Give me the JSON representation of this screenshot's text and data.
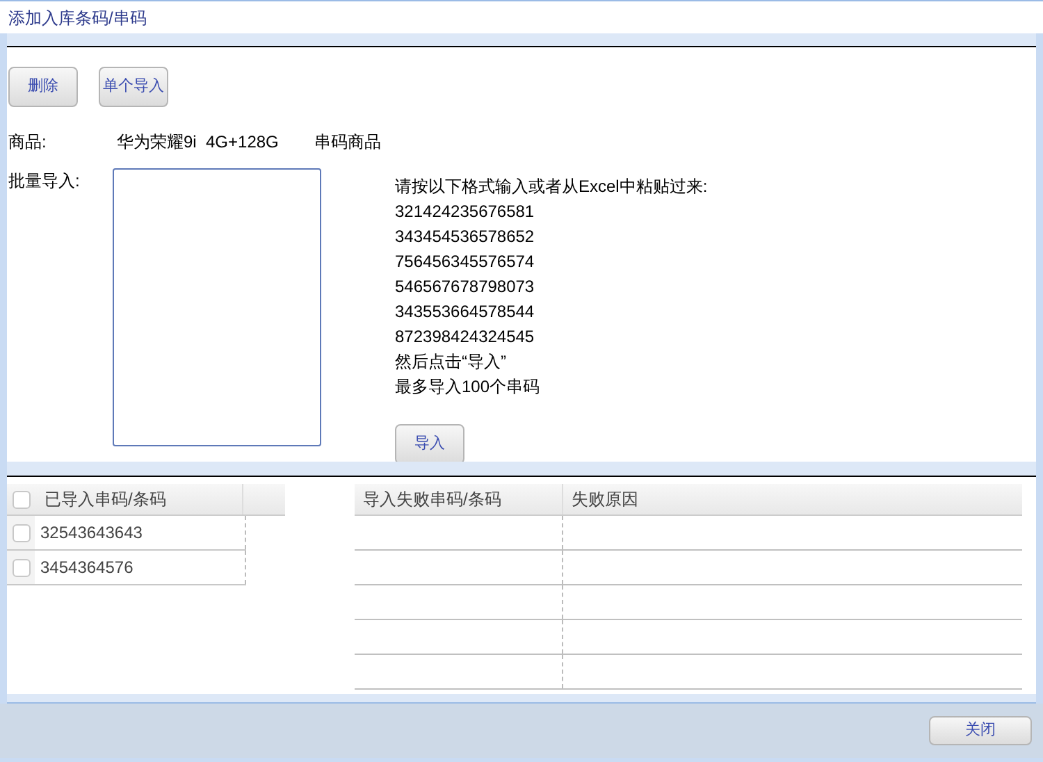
{
  "window": {
    "title": "添加入库条码/串码"
  },
  "toolbar": [
    "删除",
    "单个导入"
  ],
  "product": {
    "label": "商品:",
    "name": "华为荣耀9i  4G+128G",
    "type": "串码商品"
  },
  "batch": {
    "label": "批量导入:",
    "instructions": [
      "请按以下格式输入或者从Excel中粘贴过来:",
      "321424235676581",
      "343454536578652",
      "756456345576574",
      "546567678798073",
      "343553664578544",
      "872398424324545",
      "然后点击“导入”",
      "最多导入100个串码"
    ],
    "button": "导入"
  },
  "imported_table": {
    "all_checked": false,
    "column": "已导入串码/条码",
    "rows": [
      {
        "code": "32543643643",
        "checked": false
      },
      {
        "code": "3454364576",
        "checked": false
      }
    ]
  },
  "failed_table": {
    "columns": [
      "导入失败串码/条码",
      "失败原因"
    ]
  },
  "footer": {
    "button": "关闭"
  }
}
